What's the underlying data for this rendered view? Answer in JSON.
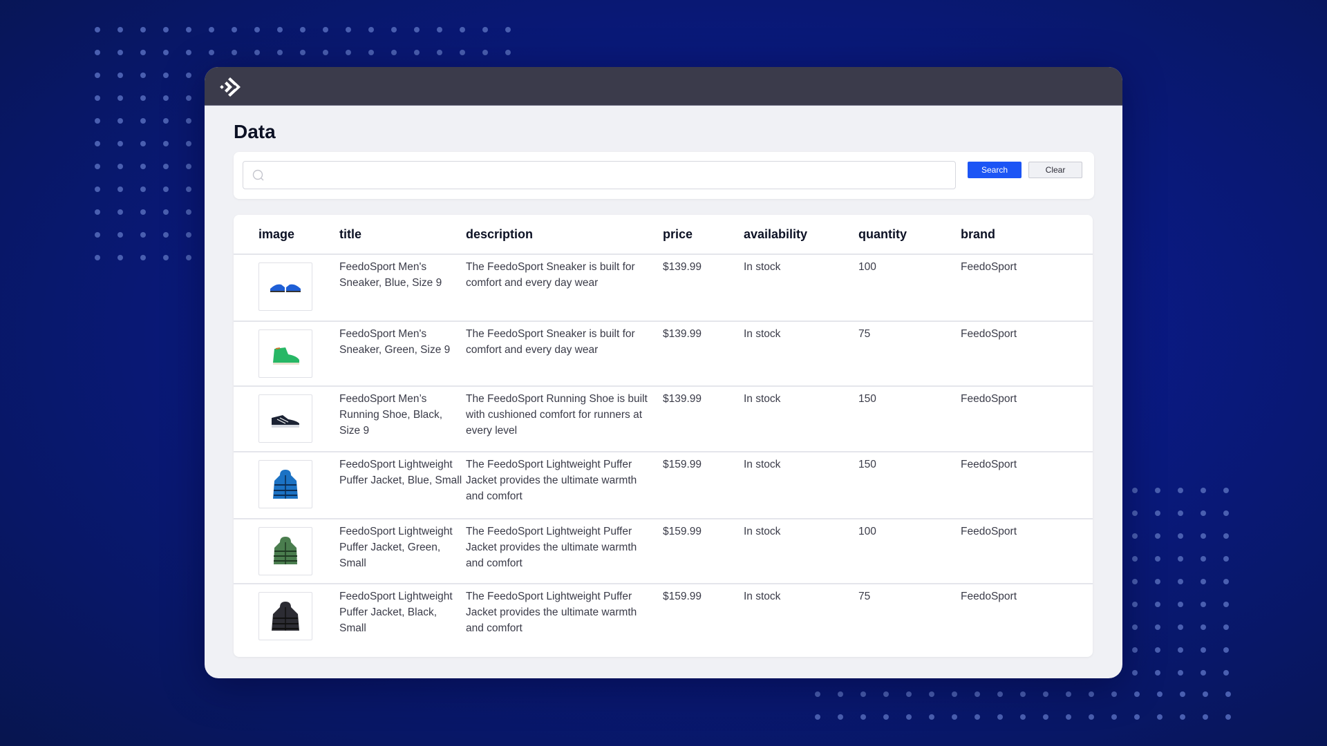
{
  "app": {
    "logo_icon": "diamond-arrow-logo-icon"
  },
  "page": {
    "title": "Data"
  },
  "search": {
    "value": "",
    "placeholder": "",
    "icon": "search-icon",
    "search_label": "Search",
    "clear_label": "Clear"
  },
  "colors": {
    "accent": "#1c55f5",
    "titlebar": "#3b3b4b",
    "background": "#0a1a86"
  },
  "table": {
    "columns": [
      "image",
      "title",
      "description",
      "price",
      "availability",
      "quantity",
      "brand"
    ],
    "rows": [
      {
        "image": "blue-sneaker",
        "title": "FeedoSport Men's Sneaker, Blue, Size 9",
        "description": "The FeedoSport Sneaker is built for comfort and every day wear",
        "price": "$139.99",
        "availability": "In stock",
        "quantity": "100",
        "brand": "FeedoSport"
      },
      {
        "image": "green-sneaker",
        "title": "FeedoSport Men's Sneaker, Green, Size 9",
        "description": "The FeedoSport Sneaker is built for comfort and every day wear",
        "price": "$139.99",
        "availability": "In stock",
        "quantity": "75",
        "brand": "FeedoSport"
      },
      {
        "image": "black-running-shoe",
        "title": "FeedoSport Men’s Running Shoe, Black, Size 9",
        "description": "The FeedoSport Running Shoe is built with cushioned comfort for runners at every level",
        "price": "$139.99",
        "availability": "In stock",
        "quantity": "150",
        "brand": "FeedoSport"
      },
      {
        "image": "blue-puffer-jacket",
        "title": "FeedoSport Lightweight Puffer Jacket, Blue, Small",
        "description": "The FeedoSport Lightweight Puffer Jacket provides the ultimate warmth and comfort",
        "price": "$159.99",
        "availability": "In stock",
        "quantity": "150",
        "brand": "FeedoSport"
      },
      {
        "image": "green-puffer-jacket",
        "title": "FeedoSport Lightweight Puffer Jacket, Green, Small",
        "description": "The FeedoSport Lightweight Puffer Jacket provides the ultimate warmth and comfort",
        "price": "$159.99",
        "availability": "In stock",
        "quantity": "100",
        "brand": "FeedoSport"
      },
      {
        "image": "black-puffer-jacket",
        "title": "FeedoSport Lightweight Puffer Jacket, Black, Small",
        "description": "The FeedoSport Lightweight Puffer Jacket provides the ultimate warmth and comfort",
        "price": "$159.99",
        "availability": "In stock",
        "quantity": "75",
        "brand": "FeedoSport"
      }
    ]
  }
}
